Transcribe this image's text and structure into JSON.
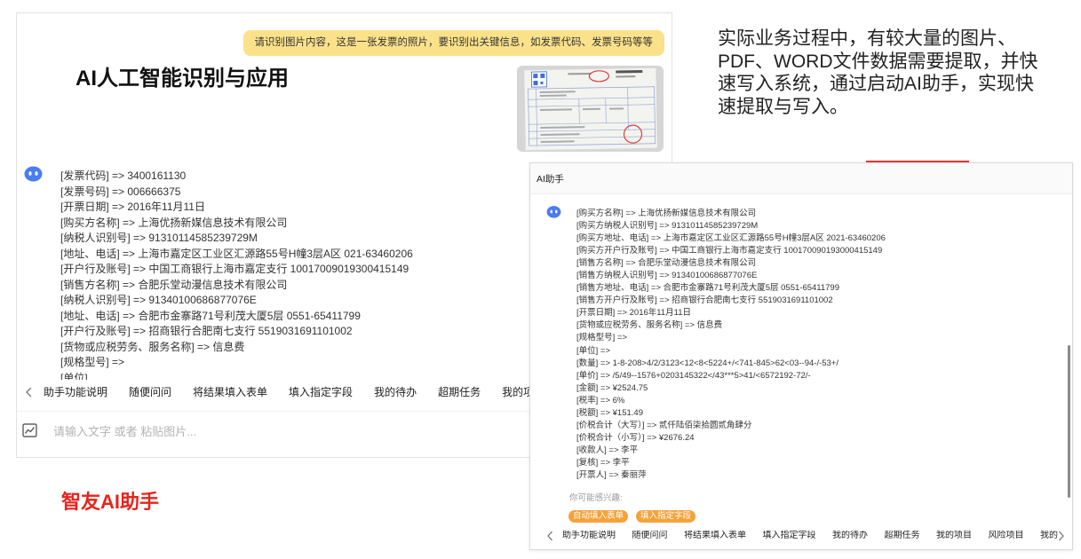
{
  "colors": {
    "bubble": "#fbe28a",
    "chip": "#f5a23a",
    "brand": "#e8231c",
    "avatar": "#4a7cf2",
    "accent_bar": "#e53935"
  },
  "left_panel": {
    "user_message": "请识别图片内容，这是一张发票的照片，要识别出关键信息，如发票代码、发票号码等等",
    "title": "AI人工智能识别与应用",
    "avatar_icon": "robot-icon",
    "result_lines": [
      "[发票代码] => 3400161130",
      "[发票号码] => 006666375",
      "[开票日期] => 2016年11月11日",
      "[购买方名称] => 上海优扬新媒信息技术有限公司",
      "[纳税人识别号] => 91310114585239729M",
      "[地址、电话] => 上海市嘉定区工业区汇源路55号H幢3层A区 021-63460206",
      "[开户行及账号] => 中国工商银行上海市嘉定支行 10017009019300415149",
      "[销售方名称] => 合肥乐堂动漫信息技术有限公司",
      "[纳税人识别号] => 91340100686877076E",
      "[地址、电话] => 合肥市金寨路71号利茂大厦5层 0551-65411799",
      "[开户行及账号] => 招商银行合肥南七支行 5519031691101002",
      "[货物或应税劳务、服务名称] => 信息费",
      "[规格型号] =>",
      "[单位]"
    ],
    "toolbar": {
      "prev_icon": "chevron-left-icon",
      "items": [
        "助手功能说明",
        "随便问问",
        "将结果填入表单",
        "填入指定字段",
        "我的待办",
        "超期任务",
        "我的项"
      ]
    },
    "input": {
      "icon": "image-icon",
      "placeholder": "请输入文字 或者 粘贴图片..."
    }
  },
  "description": {
    "lines": [
      "实际业务过程中，有较大量的图片、",
      "PDF、WORD文件数据需要提取，并快",
      "速写入系统，通过启动AI助手，实现快",
      "速提取与写入。"
    ]
  },
  "right_panel": {
    "header_title": "AI助手",
    "avatar_icon": "robot-icon",
    "result_lines": [
      "[购买方名称] => 上海优扬新媒信息技术有限公司",
      "[购买方纳税人识别号] => 91310114585239729M",
      "[购买方地址、电话] => 上海市嘉定区工业区汇源路55号H幢3层A区 2021-63460206",
      "[购买方开户行及账号] => 中国工商银行上海市嘉定支行 100170090193000415149",
      "[销售方名称] => 合肥乐堂动漫信息技术有限公司",
      "[销售方纳税人识别号] => 91340100686877076E",
      "[销售方地址、电话] => 合肥市金寨路71号利茂大厦5层 0551-65411799",
      "[销售方开户行及账号] => 招商银行合肥南七支行 5519031691101002",
      "[开票日期] => 2016年11月11日",
      "[货物或应税劳务、服务名称] => 信息费",
      "[规格型号] =>",
      "[单位] =>",
      "[数量] => 1-8-208>4/2/3123<12<8<5224+/<741-845>62<03--94-/-53+/",
      "[单价] => /5/49--1576+0203145322</43***5>41/<6572192-72/-",
      "[金额] => ¥2524.75",
      "[税率] => 6%",
      "[税额] => ¥151.49",
      "[价税合计（大写）] => 贰仟陆佰柒拾圆贰角肆分",
      "[价税合计（小写）] => ¥2676.24",
      "[收款人] => 李平",
      "[复核] => 李平",
      "[开票人] => 秦丽萍"
    ],
    "suggestions_label": "你可能感兴趣:",
    "suggestions": [
      "自动填入表单",
      "填入指定字段"
    ],
    "toolbar": {
      "prev_icon": "chevron-left-icon",
      "next_icon": "chevron-right-icon",
      "items": [
        "助手功能说明",
        "随便问问",
        "将结果填入表单",
        "填入指定字段",
        "我的待办",
        "超期任务",
        "我的项目",
        "风险项目",
        "我的"
      ]
    }
  },
  "brand_caption": "智友AI助手"
}
